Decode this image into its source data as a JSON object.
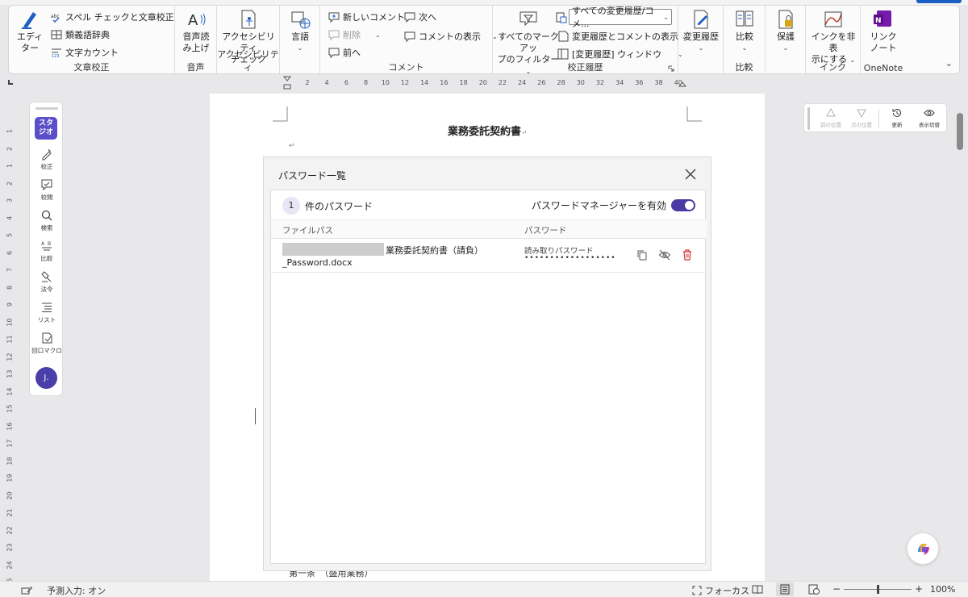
{
  "ribbon": {
    "proofing": {
      "editor_label": "エディ\nター",
      "spelling_label": "スペル チェックと文章校正",
      "thesaurus_label": "類義語辞典",
      "wordcount_label": "文字カウント",
      "group_label": "文章校正"
    },
    "speech": {
      "readaloud_label": "音声読\nみ上げ",
      "group_label": "音声"
    },
    "accessibility": {
      "check_label": "アクセシビリティ\nチェック",
      "group_label": "アクセシビリティ"
    },
    "language": {
      "language_label": "言語"
    },
    "comments": {
      "new_label": "新しいコメント",
      "delete_label": "削除",
      "prev_label": "前へ",
      "next_label": "次へ",
      "show_label": "コメントの表示",
      "group_label": "コメント"
    },
    "tracking": {
      "filter_label": "すべてのマークアッ\nプのフィルター",
      "display_value": "すべての変更履歴/コメ...",
      "show_markup_label": "変更履歴とコメントの表示",
      "pane_label": "[変更履歴] ウィンドウ",
      "group_label": "校正履歴"
    },
    "changes": {
      "label": "変更履歴"
    },
    "compare": {
      "label": "比較",
      "group_label": "比較"
    },
    "protect": {
      "label": "保護"
    },
    "ink": {
      "label": "インクを非表\n示にする",
      "group_label": "インク"
    },
    "onenote": {
      "label": "リンク\nノート",
      "group_label": "OneNote"
    }
  },
  "ruler": {
    "ticks": [
      "2",
      "4",
      "6",
      "8",
      "10",
      "12",
      "14",
      "16",
      "18",
      "20",
      "22",
      "24",
      "26",
      "28",
      "30",
      "32",
      "34",
      "36",
      "38",
      "40"
    ],
    "left_ticks": [
      "1",
      "2",
      "1",
      "2",
      "3",
      "4",
      "5",
      "6",
      "7",
      "8",
      "9",
      "10",
      "11",
      "12",
      "13",
      "14",
      "15",
      "16",
      "17",
      "18",
      "19",
      "20",
      "21",
      "22",
      "23",
      "24",
      "25",
      "26",
      "27"
    ]
  },
  "document": {
    "title": "業務委託契約書",
    "pilcrow": "↵",
    "bottom_text": "第一条　（盛用業務）"
  },
  "sidepanel": {
    "logo_text": "スタ\nジオ",
    "items": [
      {
        "label": "校正"
      },
      {
        "label": "校閲"
      },
      {
        "label": "検索"
      },
      {
        "label": "比較"
      },
      {
        "label": "法令"
      },
      {
        "label": "リスト"
      },
      {
        "label": "回口マクロ"
      }
    ],
    "avatar": "J."
  },
  "mini_toolbar": {
    "prev_label": "前の位置",
    "next_label": "次の位置",
    "refresh_label": "更新",
    "toggle_label": "表示切替"
  },
  "dialog": {
    "title": "パスワード一覧",
    "count": "1",
    "count_suffix": "件のパスワード",
    "pm_toggle_label": "パスワードマネージャーを有効",
    "col_path": "ファイルパス",
    "col_password": "パスワード",
    "rows": [
      {
        "file_a": "業務委託契約書（請負）",
        "file_b": "_Password.docx",
        "pw_type": "読み取りパスワード",
        "pw_mask": "••••••••••••••••••"
      }
    ]
  },
  "statusbar": {
    "predict_label": "予測入力: オン",
    "focus_label": "フォーカス",
    "zoom_minus": "−",
    "zoom_plus": "+",
    "zoom_value": "100%",
    "zoom_level": 0.5
  },
  "colors": {
    "accent": "#4b3aa3",
    "danger": "#d13438"
  }
}
